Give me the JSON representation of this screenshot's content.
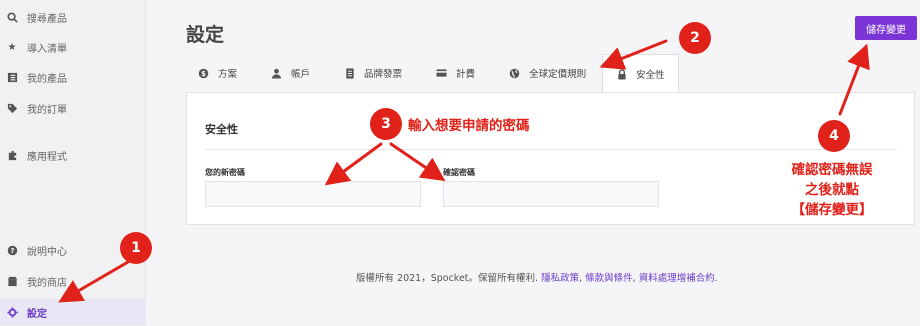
{
  "sidebar": {
    "items": [
      {
        "label": "搜尋產品",
        "icon": "search-icon"
      },
      {
        "label": "導入清單",
        "icon": "star-icon"
      },
      {
        "label": "我的產品",
        "icon": "list-icon"
      },
      {
        "label": "我的訂單",
        "icon": "tag-icon"
      },
      {
        "label": "應用程式",
        "icon": "puzzle-icon"
      },
      {
        "label": "說明中心",
        "icon": "help-icon"
      },
      {
        "label": "我的商店",
        "icon": "store-icon"
      },
      {
        "label": "設定",
        "icon": "gear-icon"
      }
    ]
  },
  "header": {
    "title": "設定",
    "save_label": "儲存變更"
  },
  "tabs": [
    {
      "label": "方案",
      "icon": "dollar-icon"
    },
    {
      "label": "帳戶",
      "icon": "user-icon"
    },
    {
      "label": "品牌發票",
      "icon": "invoice-icon"
    },
    {
      "label": "計費",
      "icon": "card-icon"
    },
    {
      "label": "全球定價規則",
      "icon": "globe-icon"
    },
    {
      "label": "安全性",
      "icon": "lock-icon"
    }
  ],
  "card": {
    "title": "安全性",
    "new_password_label": "您的新密碼",
    "confirm_password_label": "確認密碼",
    "new_password_value": "",
    "confirm_password_value": ""
  },
  "footer": {
    "text": "版權所有 2021，Spocket。保留所有權利.",
    "privacy": "隱私政策",
    "terms": "條款與條件",
    "dpa": "資料處理增補合約"
  },
  "annotations": {
    "badge1": "1",
    "badge2": "2",
    "badge3": "3",
    "badge4": "4",
    "step3_text": "輸入想要申請的密碼",
    "step4_line1": "確認密碼無誤",
    "step4_line2": "之後就點",
    "step4_line3": "【儲存變更】",
    "color": "#e0221a"
  },
  "colors": {
    "accent": "#7b35d6",
    "active_text": "#6a3cc8"
  }
}
